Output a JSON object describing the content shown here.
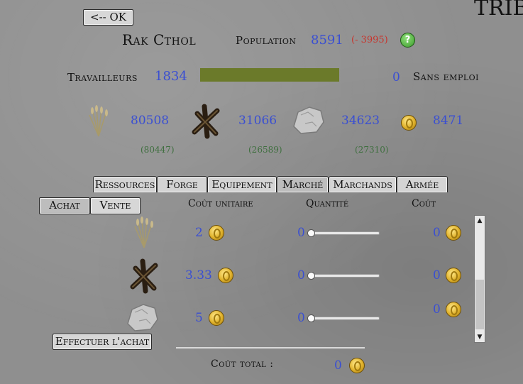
{
  "ok_button": "<-- OK",
  "corner_title": "TRIB",
  "city_name": "Rak Cthol",
  "population": {
    "label": "Population",
    "value": "8591",
    "delta": "(- 3995)"
  },
  "workers": {
    "label": "Travailleurs",
    "value": "1834",
    "unemployed_value": "0",
    "unemployed_label": "Sans emploi",
    "bar_fill_fraction": 1.0
  },
  "resources": [
    {
      "icon": "wheat-icon",
      "value": "80508",
      "sub": "(80447)"
    },
    {
      "icon": "wood-icon",
      "value": "31066",
      "sub": "(26589)"
    },
    {
      "icon": "stone-icon",
      "value": "34623",
      "sub": "(27310)"
    },
    {
      "icon": "gold-coin-icon",
      "value": "8471",
      "sub": ""
    }
  ],
  "tabs": [
    "Ressources",
    "Forge",
    "Equipement",
    "Marché",
    "Marchands",
    "Armée"
  ],
  "active_tab": "Marché",
  "subtabs": [
    "Achat",
    "Vente"
  ],
  "active_subtab": "Achat",
  "columns": {
    "unit_cost": "Coût unitaire",
    "quantity": "Quantité",
    "cost": "Coût"
  },
  "rows": [
    {
      "item": "wheat-icon",
      "unit_cost": "2",
      "quantity": "0",
      "cost": "0"
    },
    {
      "item": "wood-icon",
      "unit_cost": "3.33",
      "quantity": "0",
      "cost": "0"
    },
    {
      "item": "stone-icon",
      "unit_cost": "5",
      "quantity": "0",
      "cost": "0"
    }
  ],
  "execute_button": "Effectuer l'achat",
  "total": {
    "label": "Coût total :",
    "value": "0"
  },
  "colors": {
    "accent_blue": "#3a4fd2",
    "negative_red": "#c8342c",
    "bar_green": "#6b7a2a",
    "sub_green": "#3f6f3f"
  }
}
